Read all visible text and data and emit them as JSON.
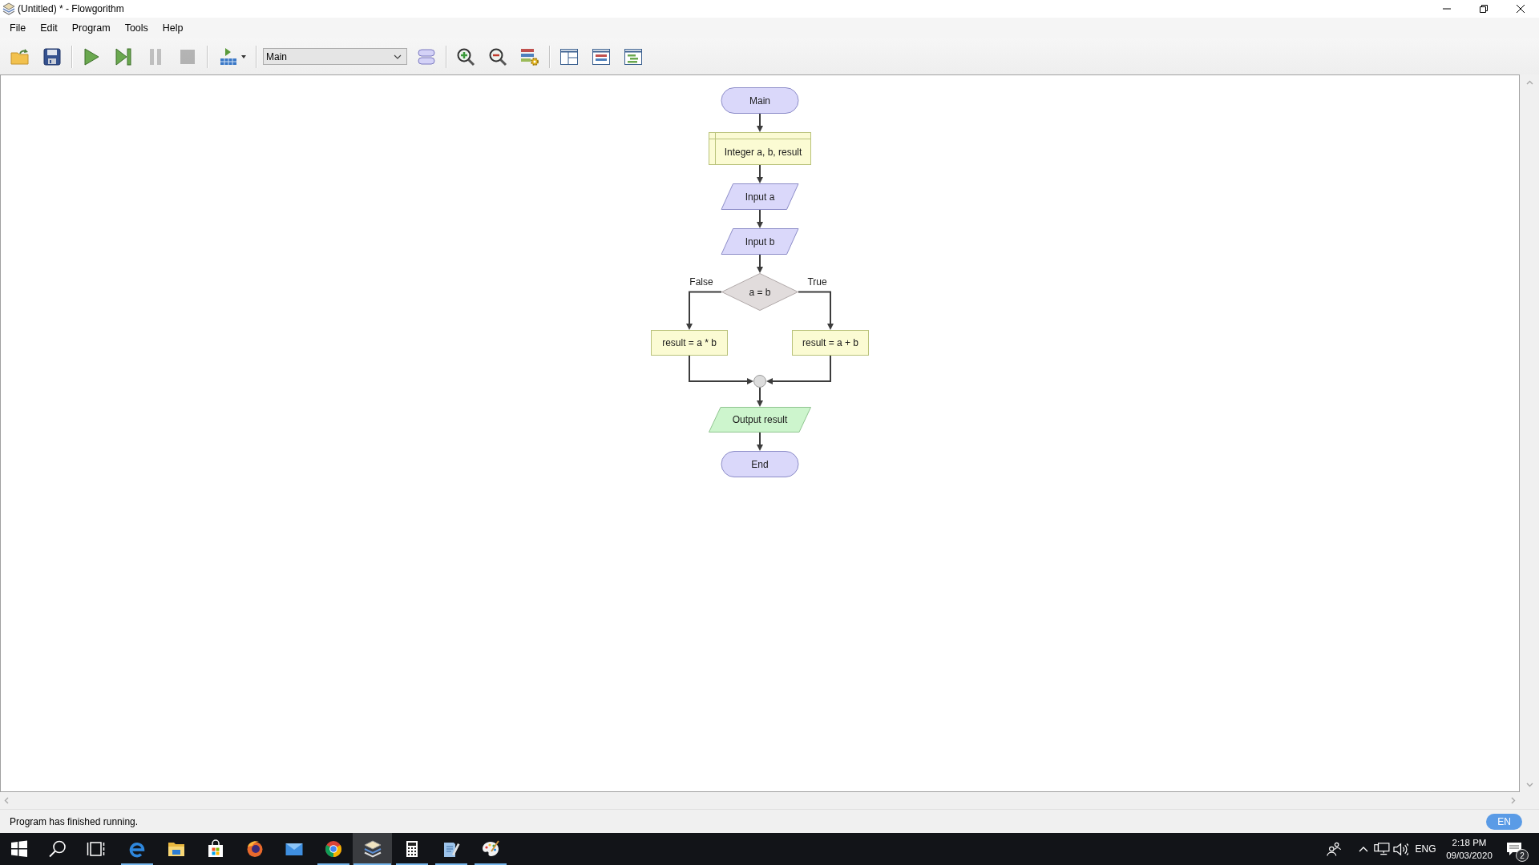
{
  "window": {
    "title": "(Untitled) * - Flowgorithm"
  },
  "menu": [
    "File",
    "Edit",
    "Program",
    "Tools",
    "Help"
  ],
  "toolbar": {
    "groups": [
      [
        {
          "kind": "open",
          "disabled": false
        },
        {
          "kind": "save",
          "disabled": false
        }
      ],
      [
        {
          "kind": "run",
          "disabled": false
        },
        {
          "kind": "step",
          "disabled": false
        },
        {
          "kind": "pause",
          "disabled": true
        },
        {
          "kind": "stop",
          "disabled": true
        }
      ],
      [
        {
          "kind": "runmenu",
          "disabled": false
        }
      ],
      [
        {
          "kind": "select",
          "value": "Main"
        },
        {
          "kind": "shapes",
          "disabled": false
        }
      ],
      [
        {
          "kind": "zoomin",
          "disabled": false
        },
        {
          "kind": "zoomout",
          "disabled": false
        },
        {
          "kind": "variables",
          "disabled": false
        }
      ],
      [
        {
          "kind": "panes",
          "disabled": false
        },
        {
          "kind": "codeview",
          "disabled": false
        },
        {
          "kind": "console",
          "disabled": false
        }
      ]
    ]
  },
  "flowchart": {
    "steps": [
      {
        "kind": "terminal",
        "text": "Main"
      },
      {
        "kind": "declare",
        "text": "Integer a, b, result"
      },
      {
        "kind": "input",
        "text": "Input a"
      },
      {
        "kind": "input",
        "text": "Input b"
      },
      {
        "kind": "decision",
        "text": "a = b",
        "false_label": "False",
        "true_label": "True",
        "false_steps": [
          {
            "kind": "assign",
            "text": "result = a * b"
          }
        ],
        "true_steps": [
          {
            "kind": "assign",
            "text": "result = a + b"
          }
        ]
      },
      {
        "kind": "output",
        "text": "Output result"
      },
      {
        "kind": "terminal",
        "text": "End"
      }
    ]
  },
  "status_bar": {
    "message": "Program has finished running.",
    "language": "EN"
  },
  "taskbar": {
    "buttons": [
      {
        "kind": "start"
      },
      {
        "kind": "search"
      },
      {
        "kind": "taskview"
      }
    ],
    "apps": [
      {
        "kind": "elogo",
        "running": true,
        "selected": false
      },
      {
        "kind": "folder",
        "running": false,
        "selected": false
      },
      {
        "kind": "bag",
        "running": false,
        "selected": false
      },
      {
        "kind": "fox",
        "running": false,
        "selected": false
      },
      {
        "kind": "mail",
        "running": false,
        "selected": false
      },
      {
        "kind": "ring",
        "running": true,
        "selected": false
      },
      {
        "kind": "layers",
        "running": true,
        "selected": true
      },
      {
        "kind": "calculator",
        "running": true,
        "selected": false
      },
      {
        "kind": "notepad",
        "running": true,
        "selected": false
      },
      {
        "kind": "palette",
        "running": true,
        "selected": false
      }
    ],
    "tray": {
      "language": "ENG",
      "time": "2:18 PM",
      "date": "09/03/2020",
      "notifications": "2"
    }
  }
}
